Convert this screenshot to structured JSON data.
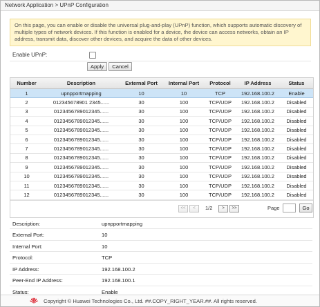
{
  "breadcrumb": "Network Application > UPnP Configuration",
  "info_text": "On this page, you can enable or disable the universal plug-and-play (UPnP) function, which supports automatic discovery of multiple types of network devices. If this function is enabled for a device, the device can access networks, obtain an IP address, transmit data, discover other devices, and acquire the data of other devices.",
  "enable_upnp": {
    "label": "Enable UPnP:",
    "checked": false
  },
  "buttons": {
    "apply": "Apply",
    "cancel": "Cancel"
  },
  "table": {
    "columns": [
      "Number",
      "Description",
      "External Port",
      "Internal Port",
      "Protocol",
      "IP Address",
      "Status"
    ],
    "selected_row": 0,
    "rows": [
      [
        "1",
        "upnpportmapping",
        "10",
        "10",
        "TCP",
        "192.168.100.2",
        "Enable"
      ],
      [
        "2",
        "012345678901 2345......",
        "30",
        "100",
        "TCP/UDP",
        "192.168.100.2",
        "Disabled"
      ],
      [
        "3",
        "0123456789012345......",
        "30",
        "100",
        "TCP/UDP",
        "192.168.100.2",
        "Disabled"
      ],
      [
        "4",
        "0123456789012345......",
        "30",
        "100",
        "TCP/UDP",
        "192.168.100.2",
        "Disabled"
      ],
      [
        "5",
        "0123456789012345......",
        "30",
        "100",
        "TCP/UDP",
        "192.168.100.2",
        "Disabled"
      ],
      [
        "6",
        "0123456789012345......",
        "30",
        "100",
        "TCP/UDP",
        "192.168.100.2",
        "Disabled"
      ],
      [
        "7",
        "0123456789012345......",
        "30",
        "100",
        "TCP/UDP",
        "192.168.100.2",
        "Disabled"
      ],
      [
        "8",
        "0123456789012345......",
        "30",
        "100",
        "TCP/UDP",
        "192.168.100.2",
        "Disabled"
      ],
      [
        "9",
        "0123456789012345......",
        "30",
        "100",
        "TCP/UDP",
        "192.168.100.2",
        "Disabled"
      ],
      [
        "10",
        "0123456789012345......",
        "30",
        "100",
        "TCP/UDP",
        "192.168.100.2",
        "Disabled"
      ],
      [
        "11",
        "0123456789012345......",
        "30",
        "100",
        "TCP/UDP",
        "192.168.100.2",
        "Disabled"
      ],
      [
        "12",
        "0123456789012345......",
        "30",
        "100",
        "TCP/UDP",
        "192.168.100.2",
        "Disabled"
      ]
    ]
  },
  "pagination": {
    "first": "<<",
    "prev": "<",
    "next": ">",
    "last": ">>",
    "page_info": "1/2",
    "page_label": "Page",
    "page_input": "",
    "go": "Go"
  },
  "details": [
    {
      "label": "Description:",
      "value": "upnpportmapping"
    },
    {
      "label": "External Port:",
      "value": "10"
    },
    {
      "label": "Internal Port:",
      "value": "10"
    },
    {
      "label": "Protocol:",
      "value": "TCP"
    },
    {
      "label": "IP Address:",
      "value": "192.168.100.2"
    },
    {
      "label": "Peer-End IP Address:",
      "value": "192.168.100.1"
    },
    {
      "label": "Status:",
      "value": "Enable"
    }
  ],
  "footer": {
    "copyright": "Copyright © Huawei Technologies Co., Ltd. ##.COPY_RIGHT_YEAR.##. All rights reserved.",
    "logo_icon": "huawei-logo",
    "brand_color": "#d7000f"
  },
  "colors": {
    "selected_row": "#cde4f7",
    "info_background": "#fff6cf"
  }
}
